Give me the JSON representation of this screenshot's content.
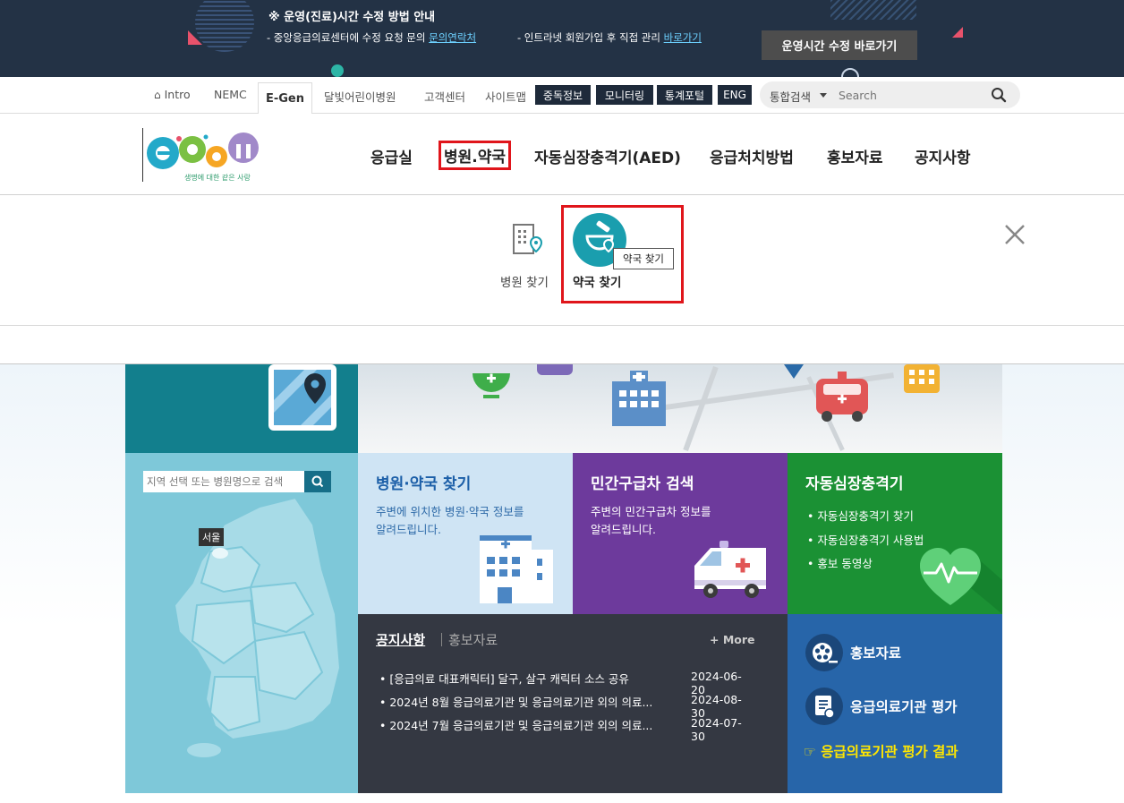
{
  "banner": {
    "title": "※ 운영(진료)시간 수정 방법 안내",
    "line1_prefix": "- 중앙응급의료센터에 수정 요청 문의 ",
    "line1_link": "문의연락처",
    "line2_prefix": "- 인트라넷 회원가입 후 직접 관리 ",
    "line2_link": "바로가기",
    "button": "운영시간 수정 바로가기"
  },
  "util": {
    "intro": "Intro",
    "nemc": "NEMC",
    "egen": "E-Gen",
    "moon_hospital": "달빛어린이병원",
    "customer": "고객센터",
    "sitemap": "사이트맵",
    "dark_buttons": [
      "중독정보",
      "모니터링",
      "통계포털",
      "ENG"
    ],
    "search_select": "통합검색",
    "search_placeholder": "Search"
  },
  "logo": {
    "tagline": "생명에 대한 같은 사랑"
  },
  "gnb": [
    "응급실",
    "병원.약국",
    "자동심장충격기(AED)",
    "응급처치방법",
    "홍보자료",
    "공지사항"
  ],
  "submenu": {
    "hospital": "병원 찾기",
    "pharmacy": "약국 찾기",
    "tooltip": "약국 찾기"
  },
  "map": {
    "search_placeholder": "지역 선택 또는 병원명으로 검색",
    "seoul": "서울"
  },
  "tiles": {
    "hospital_title": "병원·약국 찾기",
    "hospital_desc1": "주변에 위치한 병원·약국 정보를",
    "hospital_desc2": "알려드립니다.",
    "ambulance_title": "민간구급차 검색",
    "ambulance_desc1": "주변의 민간구급차 정보를",
    "ambulance_desc2": "알려드립니다.",
    "aed_title": "자동심장충격기",
    "aed_items": [
      "• 자동심장충격기 찾기",
      "• 자동심장충격기 사용법",
      "• 홍보 동영상"
    ]
  },
  "notice": {
    "tab_on": "공지사항",
    "tab_off": "홍보자료",
    "more": "+ More",
    "rows": [
      {
        "text": "• [응급의료 대표캐릭터] 달구, 살구 캐릭터 소스 공유",
        "date": "2024-06-20"
      },
      {
        "text": "• 2024년 8월 응급의료기관 및 응급의료기관 외의 의료...",
        "date": "2024-08-30"
      },
      {
        "text": "• 2024년 7월 응급의료기관 및 응급의료기관 외의 의료...",
        "date": "2024-07-30"
      }
    ]
  },
  "side": {
    "promo": "홍보자료",
    "eval": "응급의료기관 평가",
    "eval_result": "☞ 응급의료기관 평가 결과"
  },
  "colors": {
    "banner_bg": "#233245",
    "active_outline": "#e0151b",
    "teal": "#127f8d",
    "purple": "#6d3a9c",
    "green": "#1b9134",
    "navy_panel": "#343842",
    "blue_panel": "#2765a9"
  }
}
